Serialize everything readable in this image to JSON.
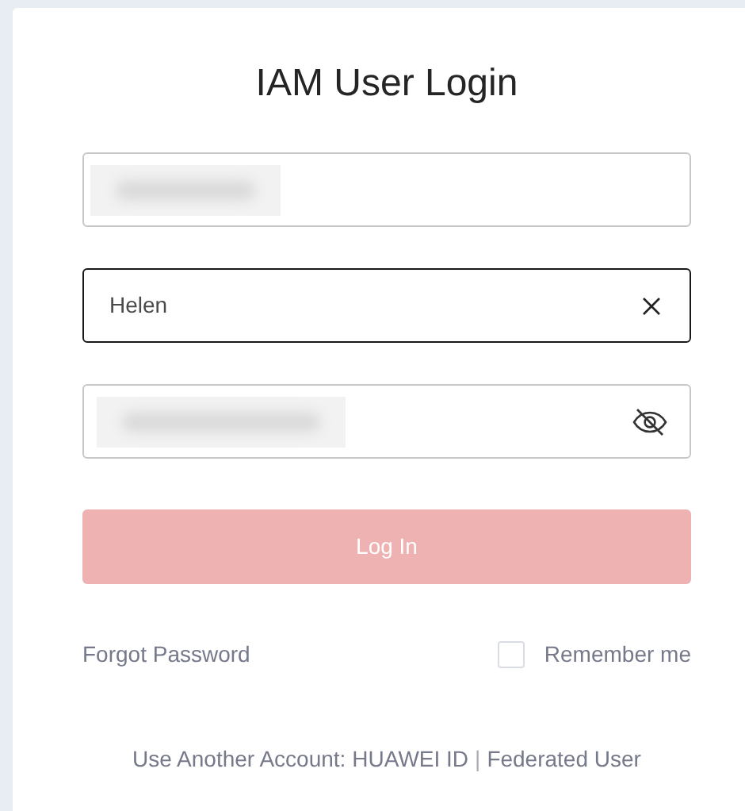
{
  "title": "IAM User Login",
  "fields": [
    {
      "kind": "redacted",
      "focused": false
    },
    {
      "kind": "text",
      "value": "Helen",
      "focused": true
    },
    {
      "kind": "password",
      "focused": false
    }
  ],
  "login_button": {
    "label": "Log In",
    "disabled": true
  },
  "forgot_link": "Forgot Password",
  "remember": {
    "label": "Remember me",
    "checked": false
  },
  "footer": {
    "prefix": "Use Another Account:",
    "links": [
      "HUAWEI ID",
      "Federated User"
    ],
    "separator": "|"
  }
}
